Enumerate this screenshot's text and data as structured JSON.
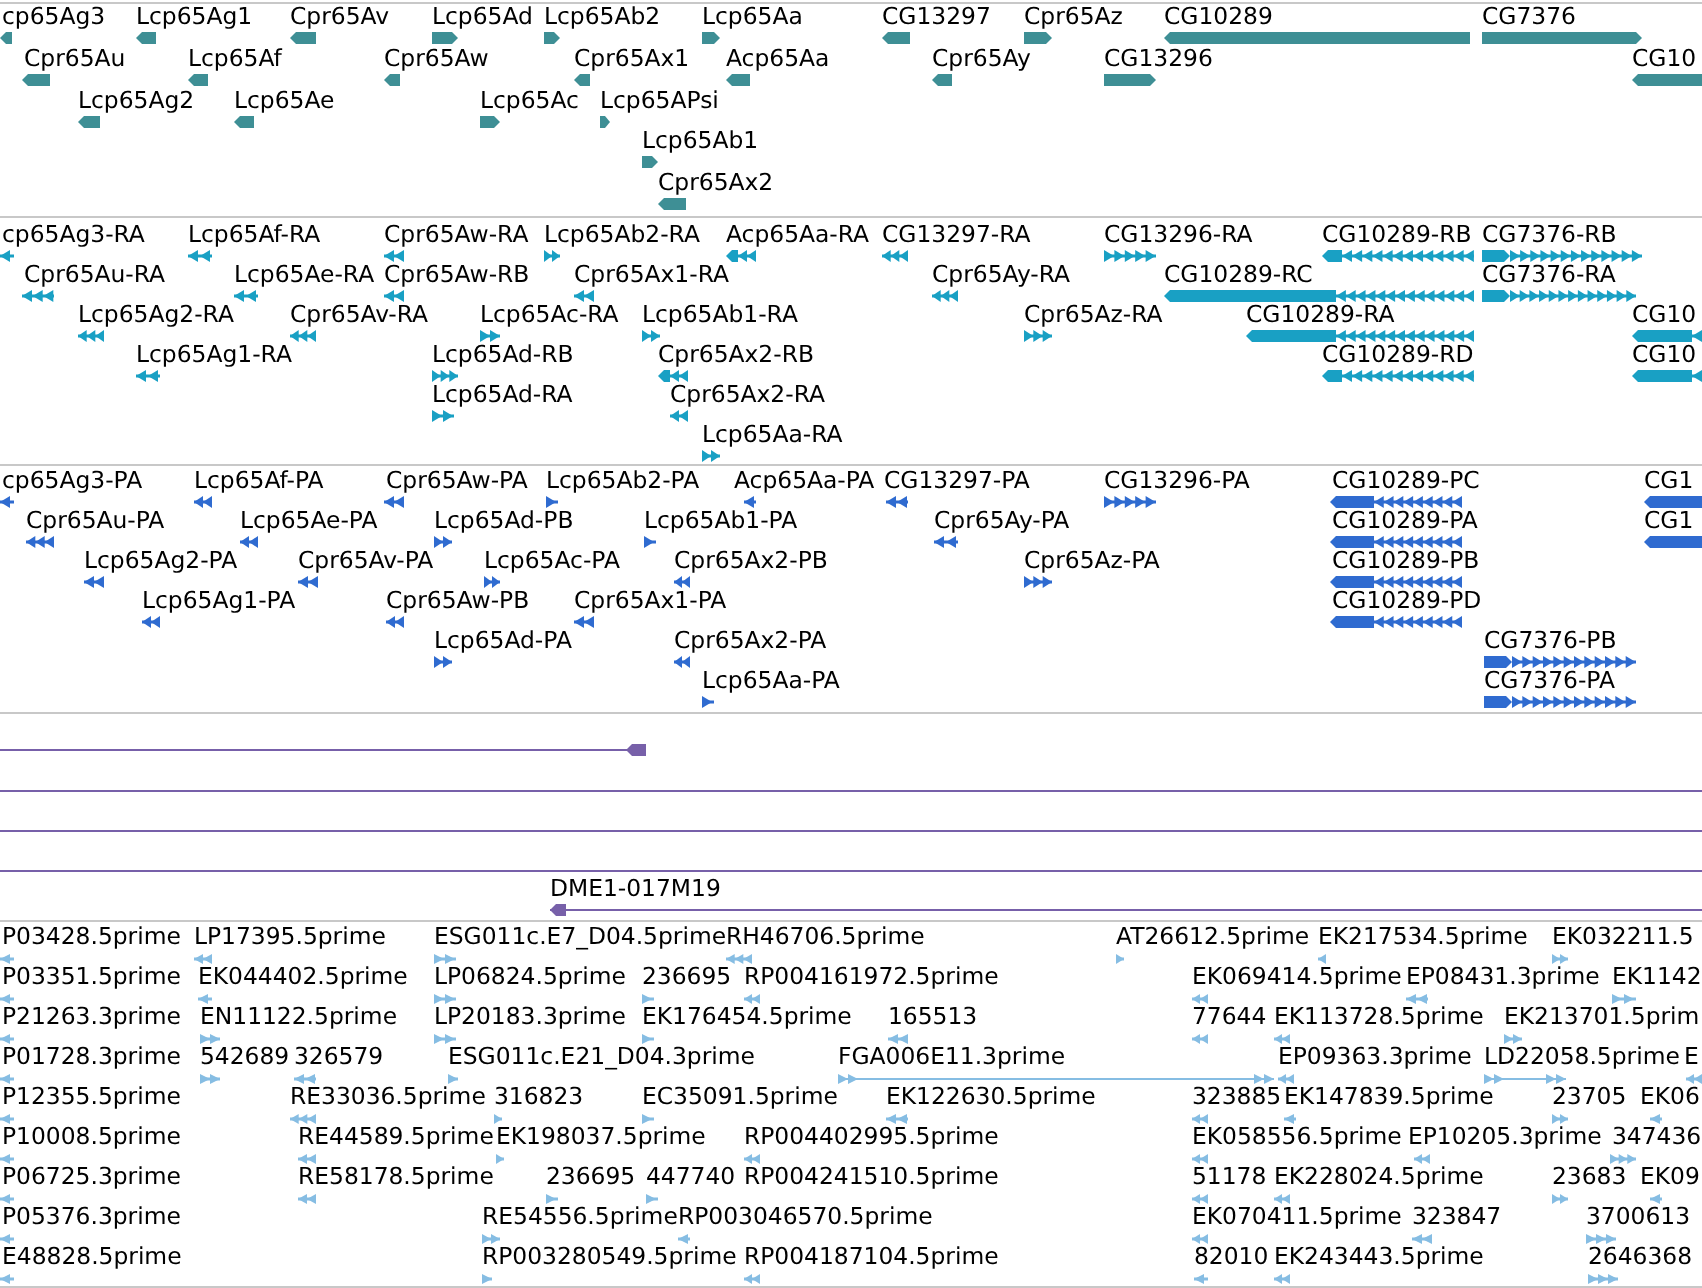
{
  "tracks": [
    {
      "kind": "gene",
      "rows": [
        {
          "features": [
            {
              "label": "cp65Ag3",
              "forward": false
            },
            {
              "label": "Lcp65Ag1",
              "forward": false
            },
            {
              "label": "Cpr65Av",
              "forward": false
            },
            {
              "label": "Lcp65Ad",
              "forward": true
            },
            {
              "label": "Lcp65Ab2",
              "forward": true
            },
            {
              "label": "Lcp65Aa",
              "forward": true
            },
            {
              "label": "CG13297",
              "forward": false
            },
            {
              "label": "Cpr65Az",
              "forward": true
            },
            {
              "label": "CG10289",
              "forward": false
            },
            {
              "label": "CG7376",
              "forward": true
            }
          ]
        },
        {
          "features": [
            {
              "label": "Cpr65Au",
              "forward": false
            },
            {
              "label": "Lcp65Af",
              "forward": false
            },
            {
              "label": "Cpr65Aw",
              "forward": false
            },
            {
              "label": "Cpr65Ax1",
              "forward": false
            },
            {
              "label": "Acp65Aa",
              "forward": false
            },
            {
              "label": "Cpr65Ay",
              "forward": false
            },
            {
              "label": "CG13296",
              "forward": true
            },
            {
              "label": "CG10",
              "forward": false
            }
          ]
        },
        {
          "features": [
            {
              "label": "Lcp65Ag2",
              "forward": false
            },
            {
              "label": "Lcp65Ae",
              "forward": false
            },
            {
              "label": "Lcp65Ac",
              "forward": true
            },
            {
              "label": "Lcp65APsi",
              "forward": true
            }
          ]
        },
        {
          "features": [
            {
              "label": "Lcp65Ab1",
              "forward": true
            }
          ]
        },
        {
          "features": [
            {
              "label": "Cpr65Ax2",
              "forward": false
            }
          ]
        }
      ]
    },
    {
      "kind": "transcript",
      "rows": [
        {
          "features": [
            {
              "label": "cp65Ag3-RA",
              "forward": false
            },
            {
              "label": "Lcp65Af-RA",
              "forward": false
            },
            {
              "label": "Cpr65Aw-RA",
              "forward": false
            },
            {
              "label": "Lcp65Ab2-RA",
              "forward": true
            },
            {
              "label": "Acp65Aa-RA",
              "forward": false
            },
            {
              "label": "CG13297-RA",
              "forward": false
            },
            {
              "label": "CG13296-RA",
              "forward": true
            },
            {
              "label": "CG10289-RB",
              "forward": false
            },
            {
              "label": "CG7376-RB",
              "forward": true
            }
          ]
        },
        {
          "features": [
            {
              "label": "Cpr65Au-RA",
              "forward": false
            },
            {
              "label": "Lcp65Ae-RA",
              "forward": false
            },
            {
              "label": "Cpr65Aw-RB",
              "forward": false
            },
            {
              "label": "Cpr65Ax1-RA",
              "forward": false
            },
            {
              "label": "Cpr65Ay-RA",
              "forward": false
            },
            {
              "label": "CG10289-RC",
              "forward": false
            },
            {
              "label": "CG7376-RA",
              "forward": true
            }
          ]
        },
        {
          "features": [
            {
              "label": "Lcp65Ag2-RA",
              "forward": false
            },
            {
              "label": "Cpr65Av-RA",
              "forward": false
            },
            {
              "label": "Lcp65Ac-RA",
              "forward": true
            },
            {
              "label": "Lcp65Ab1-RA",
              "forward": true
            },
            {
              "label": "Cpr65Az-RA",
              "forward": true
            },
            {
              "label": "CG10289-RA",
              "forward": false
            },
            {
              "label": "CG10",
              "forward": false
            }
          ]
        },
        {
          "features": [
            {
              "label": "Lcp65Ag1-RA",
              "forward": false
            },
            {
              "label": "Lcp65Ad-RB",
              "forward": true
            },
            {
              "label": "Cpr65Ax2-RB",
              "forward": false
            },
            {
              "label": "CG10289-RD",
              "forward": false
            },
            {
              "label": "CG10",
              "forward": false
            }
          ]
        },
        {
          "features": [
            {
              "label": "Lcp65Ad-RA",
              "forward": true
            },
            {
              "label": "Cpr65Ax2-RA",
              "forward": false
            }
          ]
        },
        {
          "features": [
            {
              "label": "Lcp65Aa-RA",
              "forward": true
            }
          ]
        }
      ]
    },
    {
      "kind": "protein",
      "rows": [
        {
          "features": [
            {
              "label": "cp65Ag3-PA",
              "forward": false
            },
            {
              "label": "Lcp65Af-PA",
              "forward": false
            },
            {
              "label": "Cpr65Aw-PA",
              "forward": false
            },
            {
              "label": "Lcp65Ab2-PA",
              "forward": true
            },
            {
              "label": "Acp65Aa-PA",
              "forward": false
            },
            {
              "label": "CG13297-PA",
              "forward": false
            },
            {
              "label": "CG13296-PA",
              "forward": true
            },
            {
              "label": "CG10289-PC",
              "forward": false
            },
            {
              "label": "CG1",
              "forward": false
            }
          ]
        },
        {
          "features": [
            {
              "label": "Cpr65Au-PA",
              "forward": false
            },
            {
              "label": "Lcp65Ae-PA",
              "forward": false
            },
            {
              "label": "Lcp65Ad-PB",
              "forward": true
            },
            {
              "label": "Lcp65Ab1-PA",
              "forward": true
            },
            {
              "label": "Cpr65Ay-PA",
              "forward": false
            },
            {
              "label": "CG10289-PA",
              "forward": false
            },
            {
              "label": "CG1",
              "forward": false
            }
          ]
        },
        {
          "features": [
            {
              "label": "Lcp65Ag2-PA",
              "forward": false
            },
            {
              "label": "Cpr65Av-PA",
              "forward": false
            },
            {
              "label": "Lcp65Ac-PA",
              "forward": true
            },
            {
              "label": "Cpr65Ax2-PB",
              "forward": false
            },
            {
              "label": "Cpr65Az-PA",
              "forward": true
            },
            {
              "label": "CG10289-PB",
              "forward": false
            }
          ]
        },
        {
          "features": [
            {
              "label": "Lcp65Ag1-PA",
              "forward": false
            },
            {
              "label": "Cpr65Aw-PB",
              "forward": false
            },
            {
              "label": "Cpr65Ax1-PA",
              "forward": false
            },
            {
              "label": "CG10289-PD",
              "forward": false
            }
          ]
        },
        {
          "features": [
            {
              "label": "Lcp65Ad-PA",
              "forward": true
            },
            {
              "label": "Cpr65Ax2-PA",
              "forward": false
            },
            {
              "label": "CG7376-PB",
              "forward": true
            }
          ]
        },
        {
          "features": [
            {
              "label": "Lcp65Aa-PA",
              "forward": true
            },
            {
              "label": "CG7376-PA",
              "forward": true
            }
          ]
        }
      ]
    },
    {
      "kind": "clone",
      "rows": [
        {
          "features": [
            {
              "end_marker": true,
              "forward": false
            }
          ]
        },
        {
          "features": [
            {
              "end_marker": false
            }
          ]
        },
        {
          "features": [
            {
              "end_marker": false
            }
          ]
        },
        {
          "features": [
            {
              "end_marker": false
            }
          ]
        },
        {
          "features": [
            {
              "label": "DME1-017M19",
              "end_marker": true,
              "forward": false
            }
          ]
        }
      ]
    },
    {
      "kind": "est",
      "rows": [
        {
          "features": [
            {
              "label": "P03428.5prime",
              "forward": false
            },
            {
              "label": "LP17395.5prime",
              "forward": false
            },
            {
              "label": "ESG011c.E7_D04.5prime",
              "forward": true
            },
            {
              "label": "RH46706.5prime",
              "forward": false
            },
            {
              "label": "AT26612.5prime",
              "forward": true
            },
            {
              "label": "EK217534.5prime",
              "forward": false
            },
            {
              "label": "EK032211.5",
              "forward": true
            }
          ]
        },
        {
          "features": [
            {
              "label": "P03351.5prime",
              "forward": false
            },
            {
              "label": "EK044402.5prime",
              "forward": false
            },
            {
              "label": "LP06824.5prime",
              "forward": true
            },
            {
              "label": "236695",
              "forward": true
            },
            {
              "label": "RP004161972.5prime",
              "forward": false
            },
            {
              "label": "EK069414.5prime",
              "forward": false
            },
            {
              "label": "EP08431.3prime",
              "forward": false
            },
            {
              "label": "EK1142",
              "forward": true
            }
          ]
        },
        {
          "features": [
            {
              "label": "P21263.3prime",
              "forward": false
            },
            {
              "label": "EN11122.5prime",
              "forward": true
            },
            {
              "label": "LP20183.3prime",
              "forward": true
            },
            {
              "label": "EK176454.5prime",
              "forward": true
            },
            {
              "label": "165513",
              "forward": false
            },
            {
              "label": "77644",
              "forward": false
            },
            {
              "label": "EK113728.5prime",
              "forward": false
            },
            {
              "label": "EK213701.5prim",
              "forward": true
            }
          ]
        },
        {
          "features": [
            {
              "label": "P01728.3prime",
              "forward": false
            },
            {
              "label": "542689",
              "forward": true
            },
            {
              "label": "326579",
              "forward": false
            },
            {
              "label": "ESG011c.E21_D04.3prime",
              "forward": true
            },
            {
              "label": "FGA006E11.3prime",
              "forward": true
            },
            {
              "label": "EP09363.3prime",
              "forward": false
            },
            {
              "label": "LD22058.5prime",
              "forward": true
            },
            {
              "label": "E",
              "forward": false
            }
          ]
        },
        {
          "features": [
            {
              "label": "P12355.5prime",
              "forward": false
            },
            {
              "label": "RE33036.5prime",
              "forward": false
            },
            {
              "label": "316823",
              "forward": true
            },
            {
              "label": "EC35091.5prime",
              "forward": true
            },
            {
              "label": "EK122630.5prime",
              "forward": false
            },
            {
              "label": "323885",
              "forward": false
            },
            {
              "label": "EK147839.5prime",
              "forward": false
            },
            {
              "label": "23705",
              "forward": true
            },
            {
              "label": "EK06",
              "forward": false
            }
          ]
        },
        {
          "features": [
            {
              "label": "P10008.5prime",
              "forward": false
            },
            {
              "label": "RE44589.5prime",
              "forward": false
            },
            {
              "label": "EK198037.5prime",
              "forward": true
            },
            {
              "label": "RP004402995.5prime",
              "forward": false
            },
            {
              "label": "EK058556.5prime",
              "forward": false
            },
            {
              "label": "EP10205.3prime",
              "forward": false
            },
            {
              "label": "347436",
              "forward": true
            }
          ]
        },
        {
          "features": [
            {
              "label": "P06725.3prime",
              "forward": false
            },
            {
              "label": "RE58178.5prime",
              "forward": false
            },
            {
              "label": "236695",
              "forward": true
            },
            {
              "label": "447740",
              "forward": true
            },
            {
              "label": "RP004241510.5prime"
            },
            {
              "label": "51178",
              "forward": false
            },
            {
              "label": "EK228024.5prime",
              "forward": false
            },
            {
              "label": "23683",
              "forward": true
            },
            {
              "label": "EK09",
              "forward": false
            }
          ]
        },
        {
          "features": [
            {
              "label": "P05376.3prime",
              "forward": false
            },
            {
              "label": "RE54556.5prime",
              "forward": true
            },
            {
              "label": "RP003046570.5prime",
              "forward": false
            },
            {
              "label": "EK070411.5prime",
              "forward": false
            },
            {
              "label": "323847",
              "forward": false
            },
            {
              "label": "3700613",
              "forward": true
            }
          ]
        },
        {
          "features": [
            {
              "label": "E48828.5prime",
              "forward": false
            },
            {
              "label": "RP003280549.5prime",
              "forward": true
            },
            {
              "label": "RP004187104.5prime",
              "forward": false
            },
            {
              "label": "82010",
              "forward": false
            },
            {
              "label": "EK243443.5prime",
              "forward": false
            },
            {
              "label": "2646368",
              "forward": true
            }
          ]
        }
      ]
    }
  ]
}
